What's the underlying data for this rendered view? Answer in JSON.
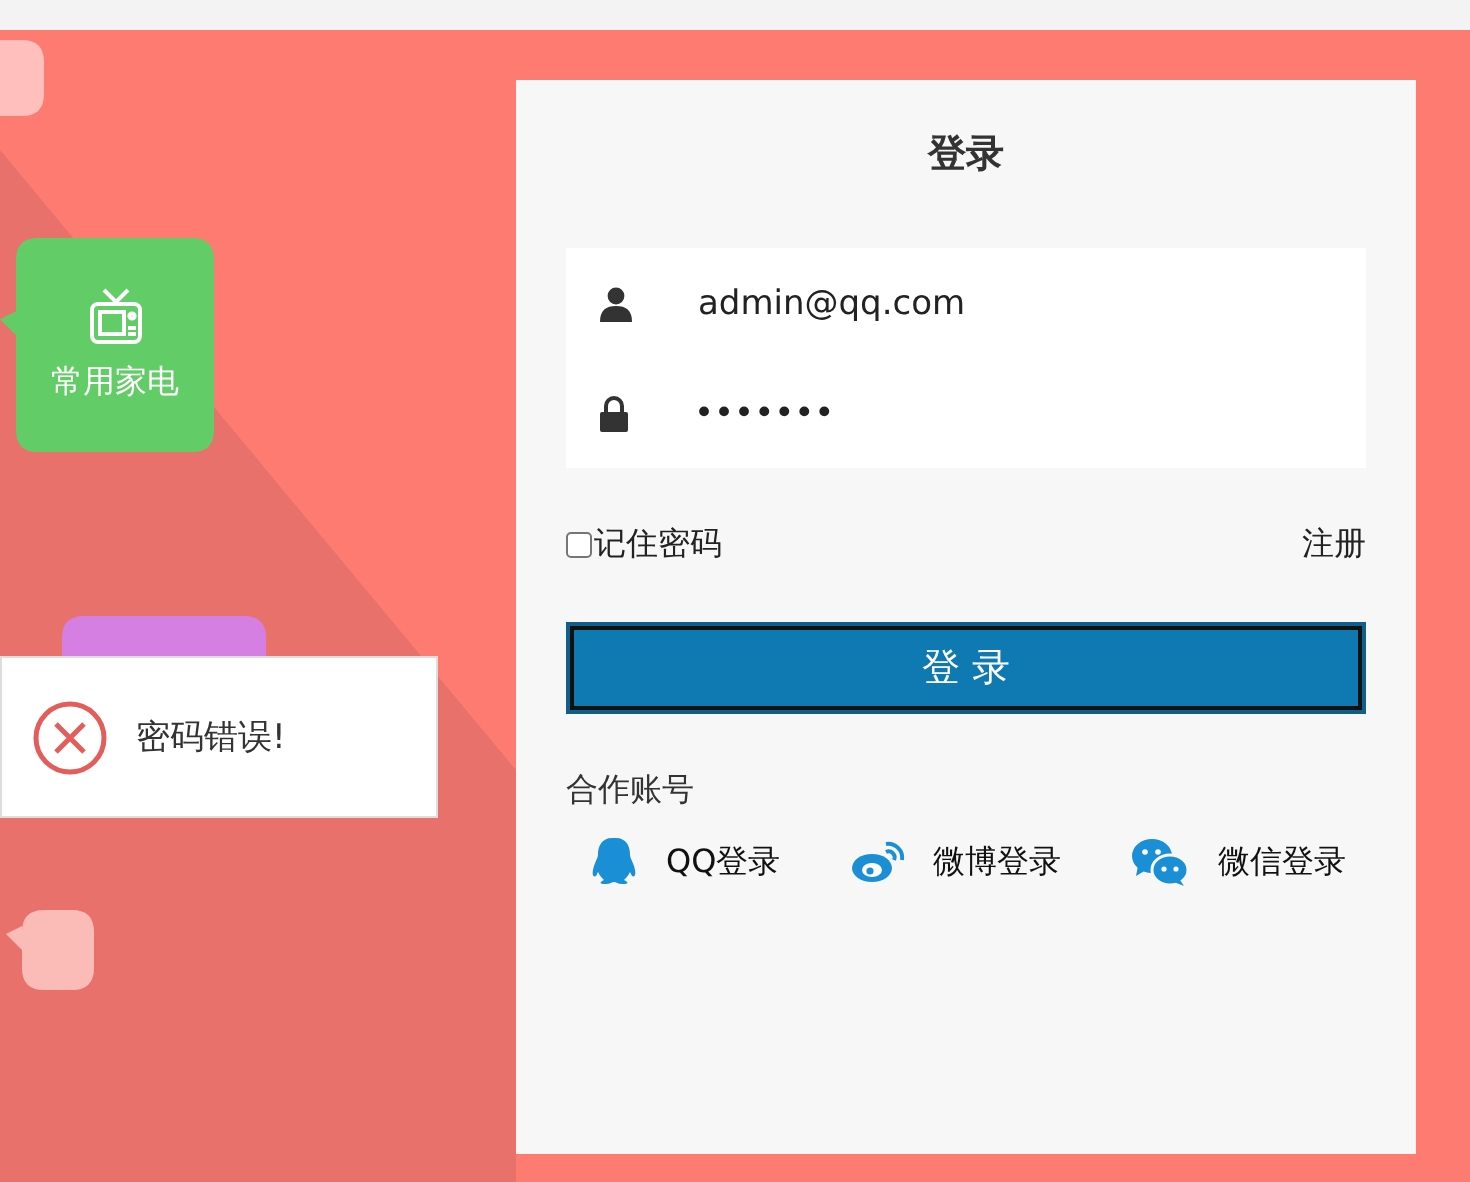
{
  "tiles": [
    {
      "kind": "blank",
      "color": "#ffc0bd"
    },
    {
      "kind": "tv",
      "color": "#62cd66",
      "label": "常用家电"
    },
    {
      "kind": "blank",
      "color": "#d57fe3"
    },
    {
      "kind": "bubble",
      "color": "#fbbcb8"
    }
  ],
  "toast": {
    "message": "密码错误!"
  },
  "login": {
    "title": "登录",
    "username": "admin@qq.com",
    "password": "•••••••",
    "remember": {
      "label": "记住密码",
      "checked": false
    },
    "register": "注册",
    "submit": "登 录",
    "partners_label": "合作账号",
    "partners": [
      {
        "kind": "qq",
        "label": "QQ登录"
      },
      {
        "kind": "weibo",
        "label": "微博登录"
      },
      {
        "kind": "wechat",
        "label": "微信登录"
      }
    ]
  }
}
